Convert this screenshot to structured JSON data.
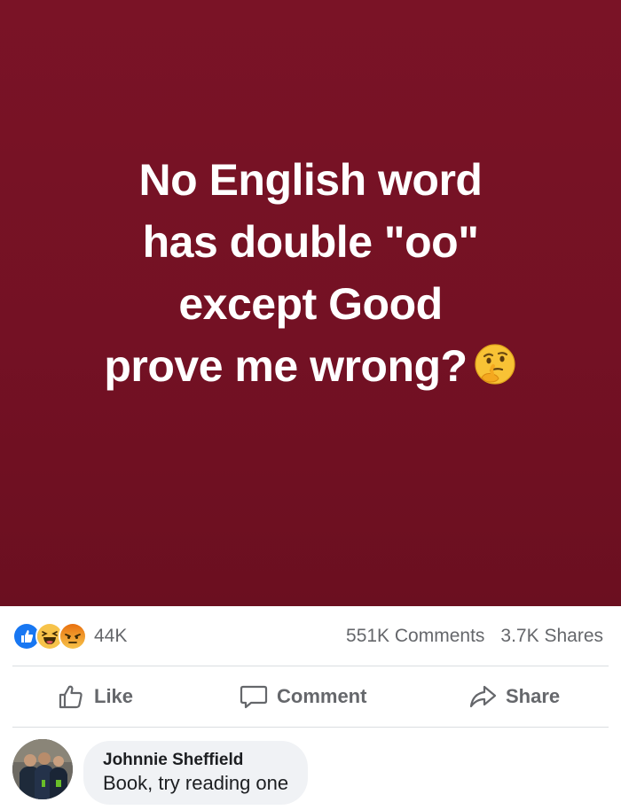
{
  "post": {
    "image_text_lines": [
      "No English word",
      "has double \"oo\"",
      "except Good",
      "prove me wrong?"
    ],
    "emoji": "thinking-face",
    "background_color": "#741124"
  },
  "stats": {
    "reactions": [
      "like",
      "haha",
      "angry"
    ],
    "reaction_count": "44K",
    "comments": "551K Comments",
    "shares": "3.7K Shares"
  },
  "actions": {
    "like_label": "Like",
    "comment_label": "Comment",
    "share_label": "Share"
  },
  "comment": {
    "author": "Johnnie Sheffield",
    "text": "Book, try reading one"
  },
  "colors": {
    "like_blue": "#1877f2",
    "reaction_yellow": "#f7c34a",
    "angry_orange": "#e9710f",
    "secondary_text": "#65676b"
  }
}
